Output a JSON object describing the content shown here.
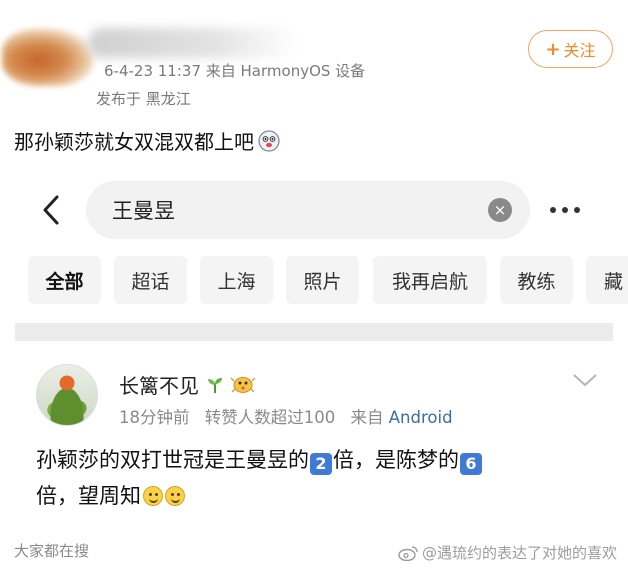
{
  "post": {
    "meta": "6-4-23 11:37  来自 HarmonyOS 设备",
    "location": "发布于 黑龙江",
    "follow_label": "关注",
    "text": "那孙颖莎就女双混双都上吧"
  },
  "search": {
    "query": "王曼昱"
  },
  "tabs": [
    "全部",
    "超话",
    "上海",
    "照片",
    "我再启航",
    "教练",
    "藏"
  ],
  "comment": {
    "username": "长篱不见",
    "time": "18分钟前",
    "repost_info": "转赞人数超过100",
    "source_prefix": "来自",
    "source_platform": "Android",
    "body_part1": "孙颖莎的双打世冠是王曼昱的",
    "badge1": "2",
    "body_part2": "倍，是陈梦的",
    "badge2": "6",
    "body_part3": "倍，望周知"
  },
  "bottom": {
    "section_label": "大家都在搜",
    "watermark": "@遇琉约的表达了对她的喜欢"
  },
  "colors": {
    "accent_orange": "#f08a2a",
    "link_blue": "#3b6ea5",
    "badge_blue": "#3f7bd6"
  },
  "icons": [
    "plus-icon",
    "ghost-emoji-icon",
    "back-arrow-icon",
    "clear-icon",
    "more-dots-icon",
    "sprout-icon",
    "fish-icon",
    "chevron-down-icon",
    "smile-emoji-icon",
    "weibo-logo-icon"
  ]
}
